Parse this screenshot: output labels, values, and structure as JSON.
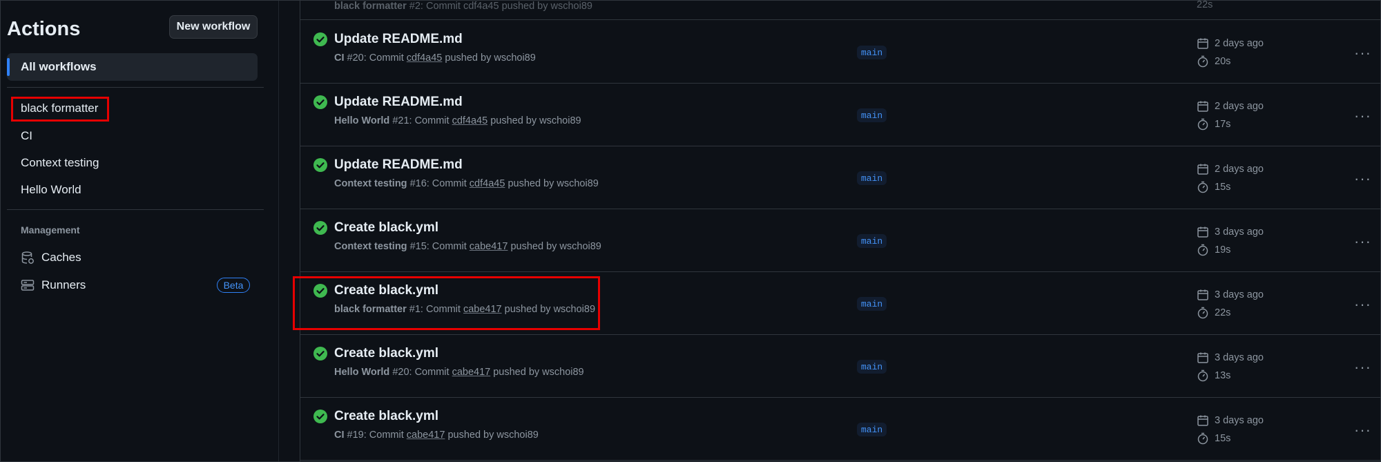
{
  "sidebar": {
    "title": "Actions",
    "new_workflow": "New workflow",
    "all_workflows": "All workflows",
    "workflows": [
      "black formatter",
      "CI",
      "Context testing",
      "Hello World"
    ],
    "management_label": "Management",
    "caches": "Caches",
    "runners": "Runners",
    "beta": "Beta"
  },
  "partial_top": {
    "workflow": "black formatter",
    "text": "#2: Commit cdf4a45 pushed by wschoi89",
    "duration": "22s"
  },
  "runs": [
    {
      "title": "Update README.md",
      "workflow": "CI",
      "run": "#20: Commit",
      "sha": "cdf4a45",
      "pushed": "pushed by wschoi89",
      "branch": "main",
      "date": "2 days ago",
      "duration": "20s"
    },
    {
      "title": "Update README.md",
      "workflow": "Hello World",
      "run": "#21: Commit",
      "sha": "cdf4a45",
      "pushed": "pushed by wschoi89",
      "branch": "main",
      "date": "2 days ago",
      "duration": "17s"
    },
    {
      "title": "Update README.md",
      "workflow": "Context testing",
      "run": "#16: Commit",
      "sha": "cdf4a45",
      "pushed": "pushed by wschoi89",
      "branch": "main",
      "date": "2 days ago",
      "duration": "15s"
    },
    {
      "title": "Create black.yml",
      "workflow": "Context testing",
      "run": "#15: Commit",
      "sha": "cabe417",
      "pushed": "pushed by wschoi89",
      "branch": "main",
      "date": "3 days ago",
      "duration": "19s"
    },
    {
      "title": "Create black.yml",
      "workflow": "black formatter",
      "run": "#1: Commit",
      "sha": "cabe417",
      "pushed": "pushed by wschoi89",
      "branch": "main",
      "date": "3 days ago",
      "duration": "22s"
    },
    {
      "title": "Create black.yml",
      "workflow": "Hello World",
      "run": "#20: Commit",
      "sha": "cabe417",
      "pushed": "pushed by wschoi89",
      "branch": "main",
      "date": "3 days ago",
      "duration": "13s"
    },
    {
      "title": "Create black.yml",
      "workflow": "CI",
      "run": "#19: Commit",
      "sha": "cabe417",
      "pushed": "pushed by wschoi89",
      "branch": "main",
      "date": "3 days ago",
      "duration": "15s"
    }
  ],
  "colors": {
    "accent": "#2f81f7",
    "success": "#3fb950",
    "highlight": "#e60000"
  }
}
